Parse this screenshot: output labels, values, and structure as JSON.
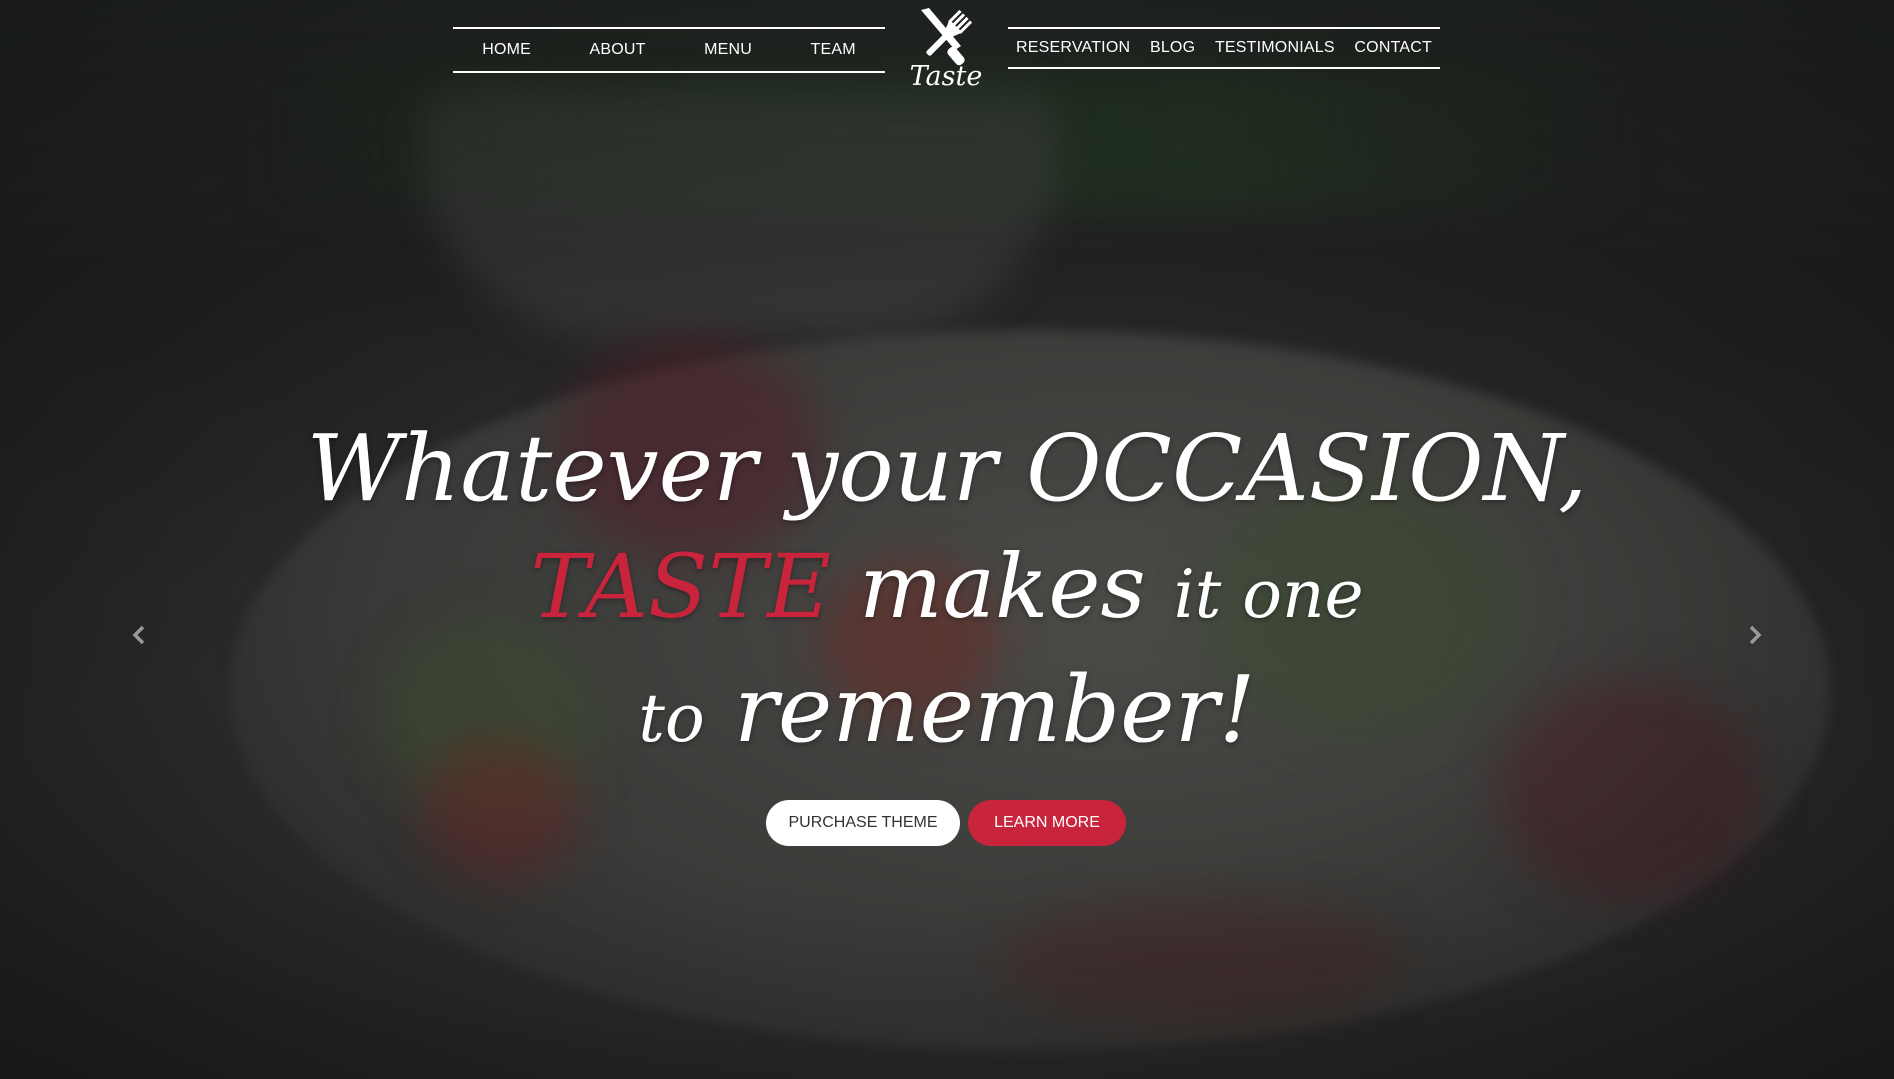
{
  "nav": {
    "left": [
      {
        "label": "HOME"
      },
      {
        "label": "ABOUT"
      },
      {
        "label": "MENU"
      },
      {
        "label": "TEAM"
      }
    ],
    "right": [
      {
        "label": "RESERVATION"
      },
      {
        "label": "BLOG"
      },
      {
        "label": "TESTIMONIALS"
      },
      {
        "label": "CONTACT"
      }
    ]
  },
  "logo": {
    "icon": "fork-knife-icon",
    "text": "Taste"
  },
  "hero": {
    "line1": "Whatever your OCCASION,",
    "line2_accent": "TASTE",
    "line2_main": "makes",
    "line2_small": "it one",
    "line3_small": "to",
    "line3_main": "remember!"
  },
  "buttons": {
    "purchase": "PURCHASE THEME",
    "learn": "LEARN MORE"
  },
  "carousel": {
    "prev_icon": "chevron-left-icon",
    "next_icon": "chevron-right-icon"
  },
  "colors": {
    "accent": "#c8243c",
    "text": "#ffffff",
    "button_light": "#ffffff"
  }
}
